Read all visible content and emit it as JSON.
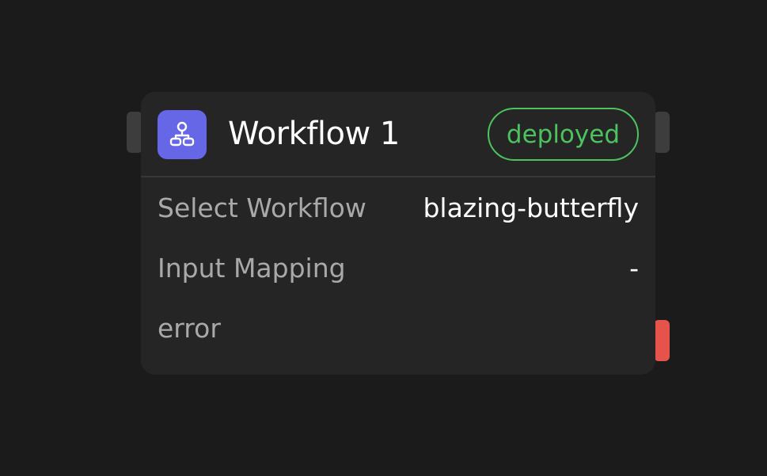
{
  "node": {
    "title": "Workflow 1",
    "icon": "workflow-tree-icon",
    "status": "deployed",
    "status_color": "#4cc35f",
    "icon_background": "#6567e6"
  },
  "fields": [
    {
      "label": "Select Workflow",
      "value": "blazing-butterfly"
    },
    {
      "label": "Input Mapping",
      "value": "-"
    },
    {
      "label": "error",
      "value": ""
    }
  ],
  "colors": {
    "canvas": "#1b1b1b",
    "card": "#252525",
    "error_handle": "#e5534b"
  }
}
